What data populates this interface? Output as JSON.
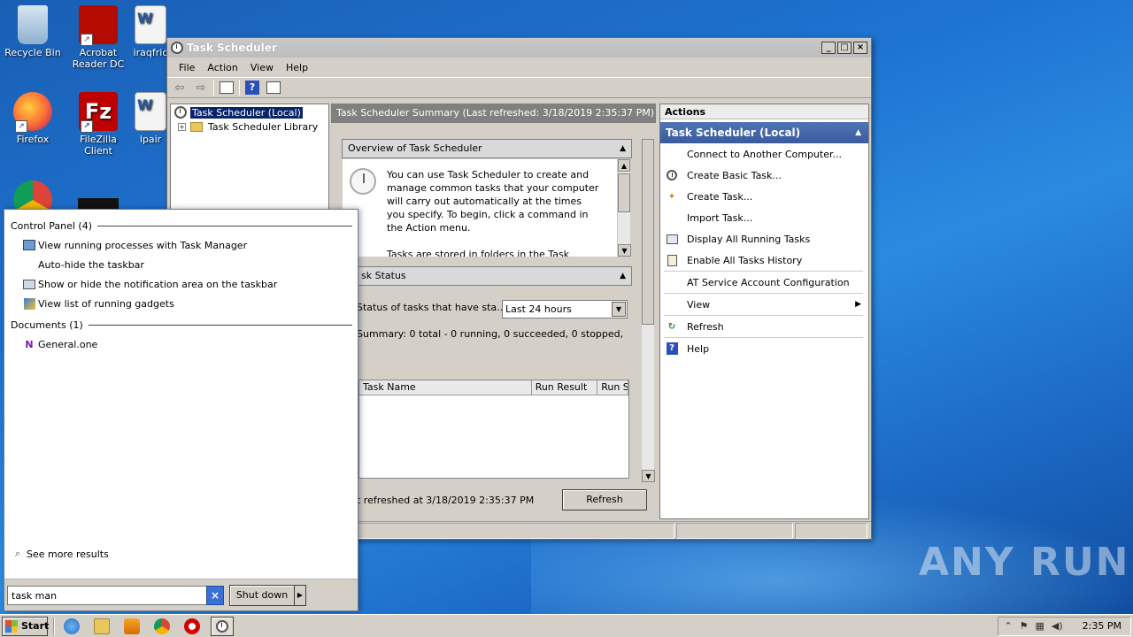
{
  "desktop": {
    "icons": [
      {
        "label": "Recycle Bin",
        "icon": "recycle-bin-icon"
      },
      {
        "label": "Acrobat Reader DC",
        "icon": "acrobat-icon"
      },
      {
        "label": "iraqfric",
        "icon": "word-doc-icon"
      },
      {
        "label": "Firefox",
        "icon": "firefox-icon"
      },
      {
        "label": "FileZilla Client",
        "icon": "filezilla-icon"
      },
      {
        "label": "lpair",
        "icon": "word-doc-icon"
      }
    ],
    "watermark": "ANY RUN"
  },
  "window": {
    "title": "Task Scheduler",
    "menu": [
      "File",
      "Action",
      "View",
      "Help"
    ],
    "tree": {
      "root": "Task Scheduler (Local)",
      "child": "Task Scheduler Library"
    },
    "center": {
      "header": "Task Scheduler Summary (Last refreshed: 3/18/2019 2:35:37 PM)",
      "overview_title": "Overview of Task Scheduler",
      "overview_text": "You can use Task Scheduler to create and manage common tasks that your computer will carry out automatically at the times you specify. To begin, click a command in the Action menu.",
      "overview_text2": "Tasks are stored in folders in the Task",
      "status_title": "sk Status",
      "status_label": "Status of tasks that have sta...",
      "status_filter": "Last 24 hours",
      "summary": "Summary: 0 total - 0 running, 0 succeeded, 0 stopped, 0...",
      "columns": [
        "Task Name",
        "Run Result",
        "Run S"
      ],
      "last_refreshed": "t refreshed at 3/18/2019 2:35:37 PM",
      "refresh_button": "Refresh"
    },
    "actions": {
      "title": "Actions",
      "group": "Task Scheduler (Local)",
      "items": [
        {
          "label": "Connect to Another Computer...",
          "icon": ""
        },
        {
          "label": "Create Basic Task...",
          "icon": "create-basic-task-icon"
        },
        {
          "label": "Create Task...",
          "icon": "create-task-icon"
        },
        {
          "label": "Import Task...",
          "icon": ""
        },
        {
          "label": "Display All Running Tasks",
          "icon": "running-tasks-icon"
        },
        {
          "label": "Enable All Tasks History",
          "icon": "history-icon"
        },
        {
          "label": "AT Service Account Configuration",
          "icon": ""
        },
        {
          "label": "View",
          "icon": ""
        },
        {
          "label": "Refresh",
          "icon": "refresh-icon"
        },
        {
          "label": "Help",
          "icon": "help-icon"
        }
      ]
    }
  },
  "start_menu": {
    "control_panel_header": "Control Panel (4)",
    "control_panel_items": [
      "View running processes with Task Manager",
      "Auto-hide the taskbar",
      "Show or hide the notification area on the taskbar",
      "View list of running gadgets"
    ],
    "documents_header": "Documents (1)",
    "documents_items": [
      "General.one"
    ],
    "see_more": "See more results",
    "search_value": "task man",
    "shutdown_label": "Shut down"
  },
  "taskbar": {
    "start_label": "Start",
    "time": "2:35 PM"
  },
  "colors": {
    "selection": "#0a246a",
    "actions_group": "#3a5c9f",
    "desktop": "#1e73d2"
  }
}
